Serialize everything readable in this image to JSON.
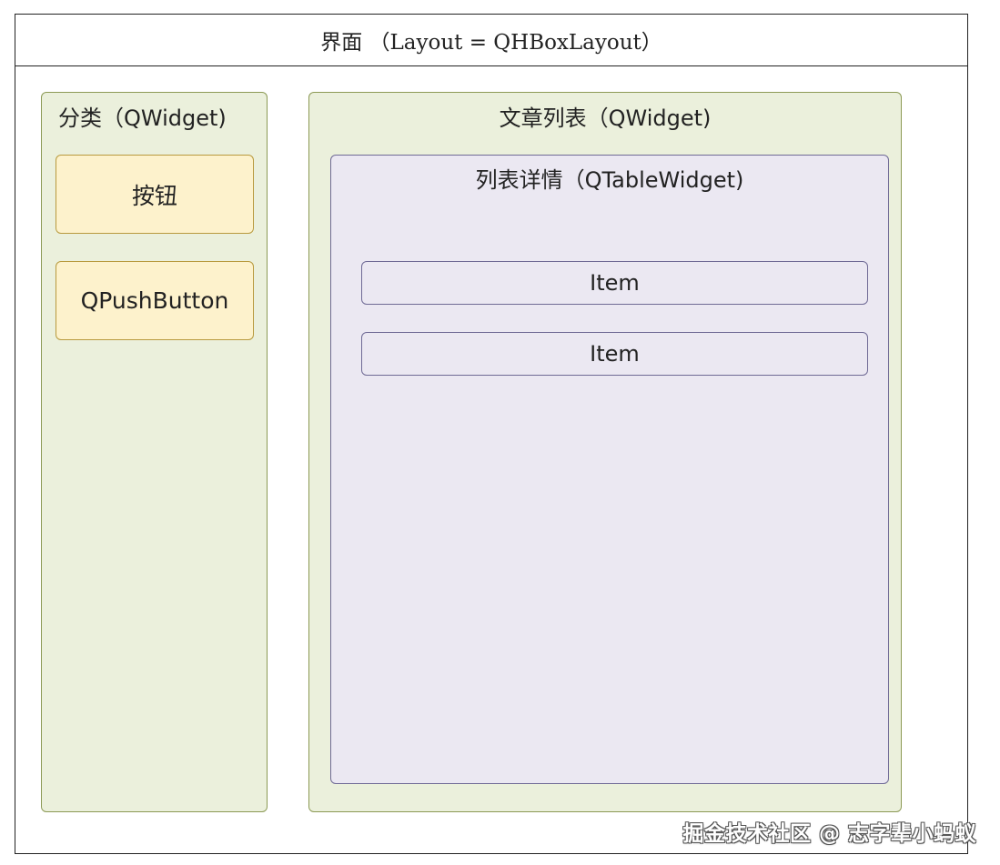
{
  "window": {
    "title": "界面 （Layout = QHBoxLayout）"
  },
  "category_panel": {
    "title": "分类（QWidget)",
    "buttons": [
      {
        "label": "按钮"
      },
      {
        "label": "QPushButton"
      }
    ]
  },
  "article_panel": {
    "title": "文章列表（QWidget)",
    "table": {
      "title": "列表详情（QTableWidget)",
      "items": [
        {
          "label": "Item"
        },
        {
          "label": "Item"
        }
      ]
    }
  },
  "watermark": "掘金技术社区 @ 志字辈小蚂蚁",
  "colors": {
    "border": "#222222",
    "panel_bg": "#ebf0dc",
    "panel_border": "#8c9a55",
    "button_bg": "#fdf2cc",
    "button_border": "#b89a3e",
    "table_bg": "#ebe8f2",
    "table_border": "#6f6a95"
  }
}
